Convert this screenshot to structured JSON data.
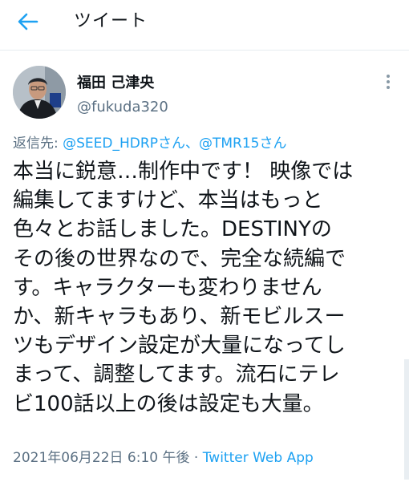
{
  "header": {
    "title": "ツイート",
    "back_icon": "back-arrow-icon",
    "accent": "#1da1f2"
  },
  "author": {
    "name": "福田 己津央",
    "handle": "@fukuda320",
    "more_icon": "vertical-dots-icon"
  },
  "reply": {
    "prefix": "返信先: ",
    "mention1": "@SEED_HDRPさん",
    "separator": "、",
    "mention2": "@TMR15さん"
  },
  "tweet": {
    "lines": [
      "本当に鋭意…制作中です！ 映像では",
      "編集してますけど、本当はもっと",
      "色々とお話しました。DESTINYの",
      "その後の世界なので、完全な続編で",
      "す。キャラクターも変わりません",
      "か、新キャラもあり、新モビルスー",
      "ツもデザイン設定が大量になってし",
      "まって、調整してます。流石にテレ",
      "ビ100話以上の後は設定も大量。"
    ]
  },
  "meta": {
    "timestamp": "2021年06月22日 6:10 午後",
    "separator": " · ",
    "source": "Twitter Web App"
  }
}
